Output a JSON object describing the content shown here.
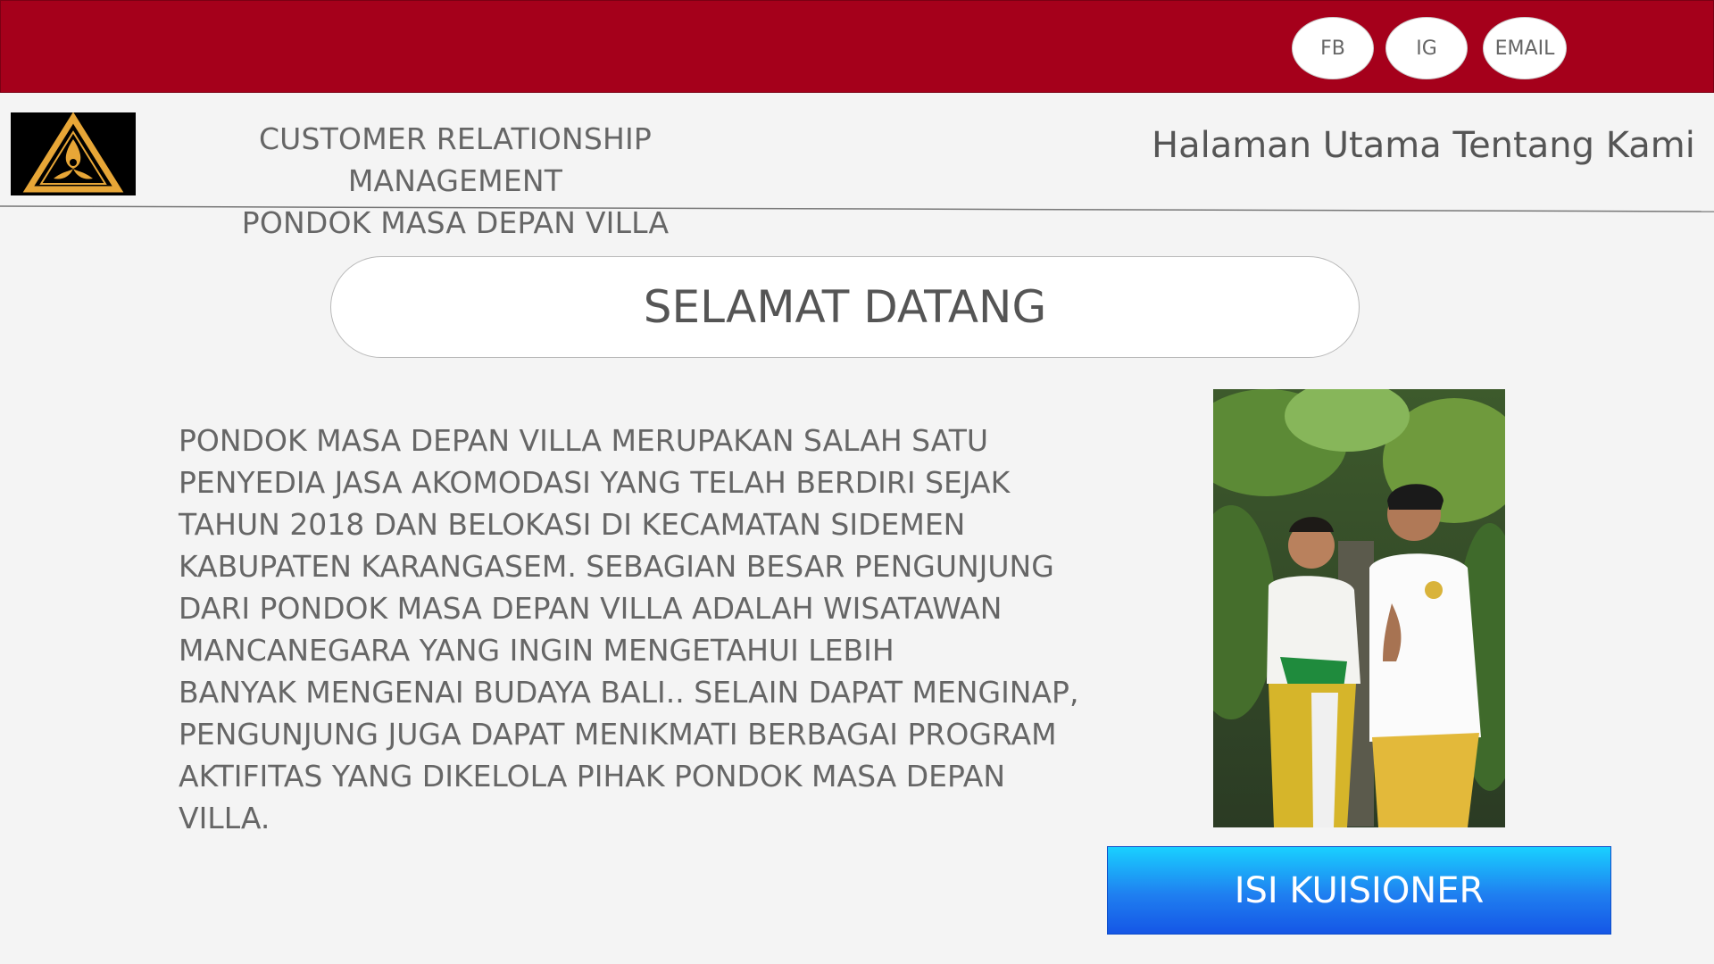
{
  "header": {
    "social": [
      {
        "label": "FB",
        "icon": "facebook-link"
      },
      {
        "label": "IG",
        "icon": "instagram-link"
      },
      {
        "label": "EMAIL",
        "icon": "email-link"
      }
    ],
    "brand_line1": "CUSTOMER RELATIONSHIP MANAGEMENT",
    "brand_line2": "PONDOK MASA DEPAN VILLA",
    "nav": [
      {
        "label": "Halaman Utama"
      },
      {
        "label": "Tentang Kami"
      }
    ],
    "logo_icon": "triangle-emblem-icon"
  },
  "main": {
    "welcome_title": "SELAMAT DATANG",
    "description": "PONDOK MASA DEPAN VILLA MERUPAKAN SALAH SATU\nPENYEDIA JASA AKOMODASI YANG TELAH BERDIRI SEJAK\nTAHUN 2018 DAN BELOKASI DI KECAMATAN SIDEMEN\nKABUPATEN KARANGASEM. SEBAGIAN BESAR PENGUNJUNG\nDARI PONDOK MASA DEPAN VILLA ADALAH WISATAWAN\nMANCANEGARA YANG INGIN MENGETAHUI LEBIH\nBANYAK MENGENAI BUDAYA BALI.. SELAIN DAPAT MENGINAP,\nPENGUNJUNG JUGA DAPAT MENIKMATI BERBAGAI PROGRAM\nAKTIFITAS YANG DIKELOLA PIHAK PONDOK MASA DEPAN VILLA.",
    "cta_label": "ISI KUISIONER"
  },
  "colors": {
    "topbar": "#a5001b",
    "button_top": "#19d0ff",
    "button_bottom": "#1556e6",
    "logo_gold": "#e7a637"
  }
}
